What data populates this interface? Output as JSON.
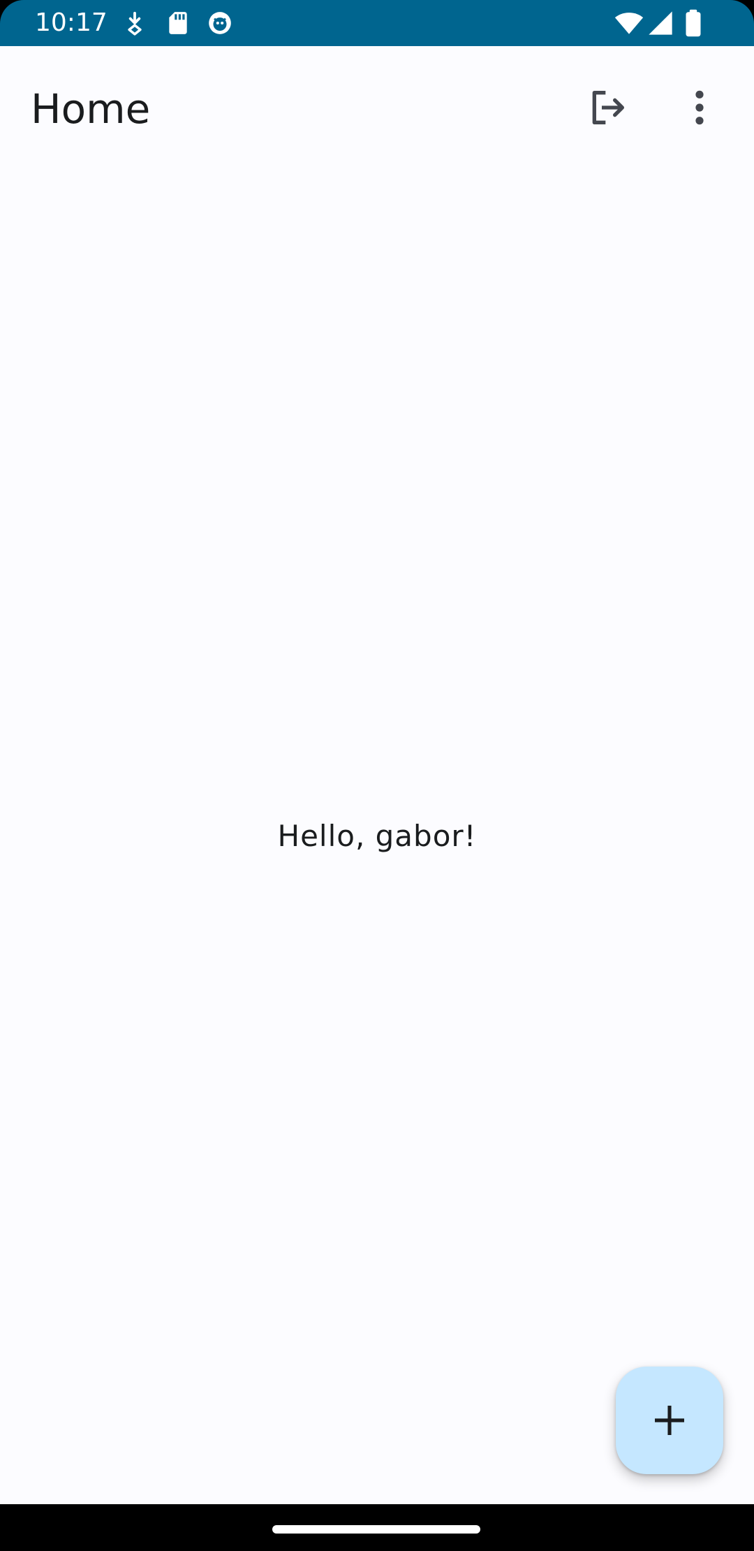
{
  "status_bar": {
    "time": "10:17",
    "background_color": "#00658f",
    "left_icons": [
      "download-status-icon",
      "sd-card-icon",
      "app-notification-icon"
    ],
    "right_icons": [
      "wifi-icon",
      "cellular-signal-icon",
      "battery-icon"
    ]
  },
  "app_bar": {
    "title": "Home",
    "actions": [
      "logout-icon",
      "more-vert-icon"
    ]
  },
  "main": {
    "greeting": "Hello, gabor!"
  },
  "fab": {
    "icon": "add-icon",
    "color": "#c5e7ff"
  },
  "colors": {
    "surface": "#fcfcff",
    "on_surface": "#1a1c1e",
    "icon": "#44474f"
  }
}
